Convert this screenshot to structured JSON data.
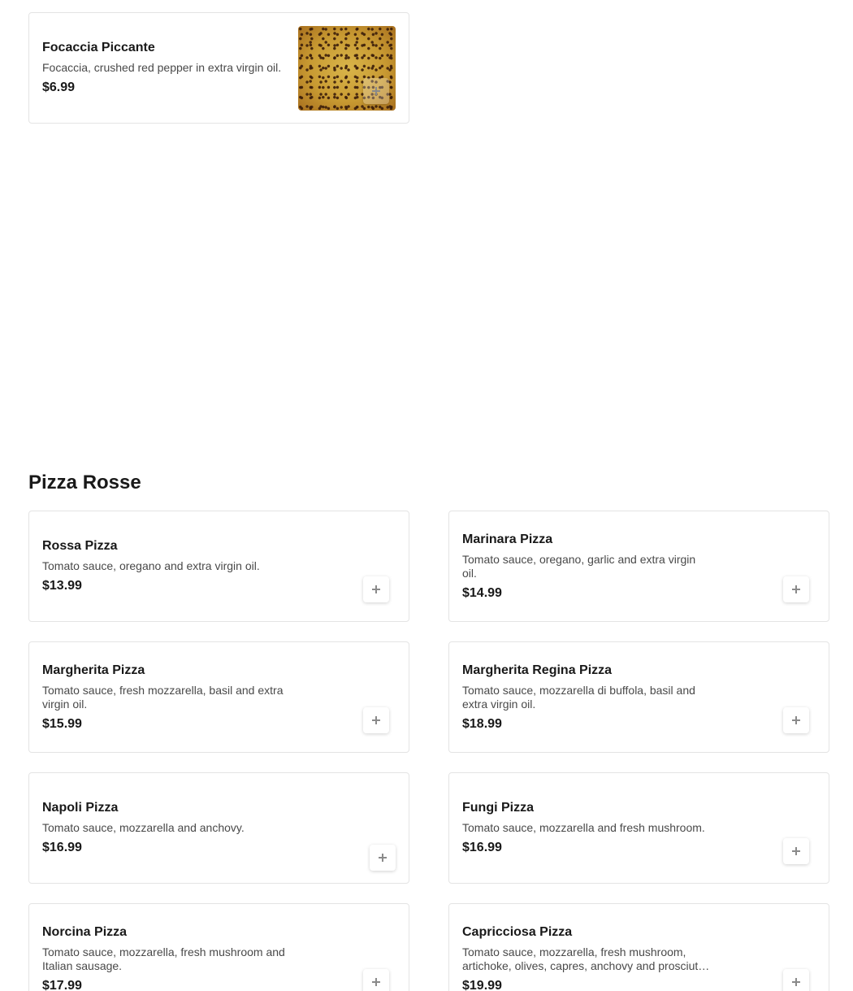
{
  "top_item": {
    "name": "Focaccia Piccante",
    "description": "Focaccia, crushed red pepper in extra virgin oil.",
    "price": "$6.99",
    "image_icon": "food-photo"
  },
  "section": {
    "title": "Pizza Rosse"
  },
  "items": [
    {
      "name": "Rossa Pizza",
      "description": "Tomato sauce, oregano and extra virgin oil.",
      "price": "$13.99"
    },
    {
      "name": "Marinara Pizza",
      "description": "Tomato sauce, oregano, garlic and extra virgin oil.",
      "price": "$14.99"
    },
    {
      "name": "Margherita Pizza",
      "description": "Tomato sauce, fresh mozzarella, basil and extra virgin oil.",
      "price": "$15.99"
    },
    {
      "name": "Margherita Regina Pizza",
      "description": "Tomato sauce, mozzarella di buffola, basil and extra virgin oil.",
      "price": "$18.99"
    },
    {
      "name": "Napoli Pizza",
      "description": "Tomato sauce, mozzarella and anchovy.",
      "price": "$16.99"
    },
    {
      "name": "Fungi Pizza",
      "description": "Tomato sauce, mozzarella and fresh mushroom.",
      "price": "$16.99"
    },
    {
      "name": "Norcina Pizza",
      "description": "Tomato sauce, mozzarella, fresh mushroom and Italian sausage.",
      "price": "$17.99"
    },
    {
      "name": "Capricciosa Pizza",
      "description": "Tomato sauce, mozzarella, fresh mushroom, artichoke, olives, capres, anchovy and prosciutto cotto.",
      "price": "$19.99"
    }
  ]
}
